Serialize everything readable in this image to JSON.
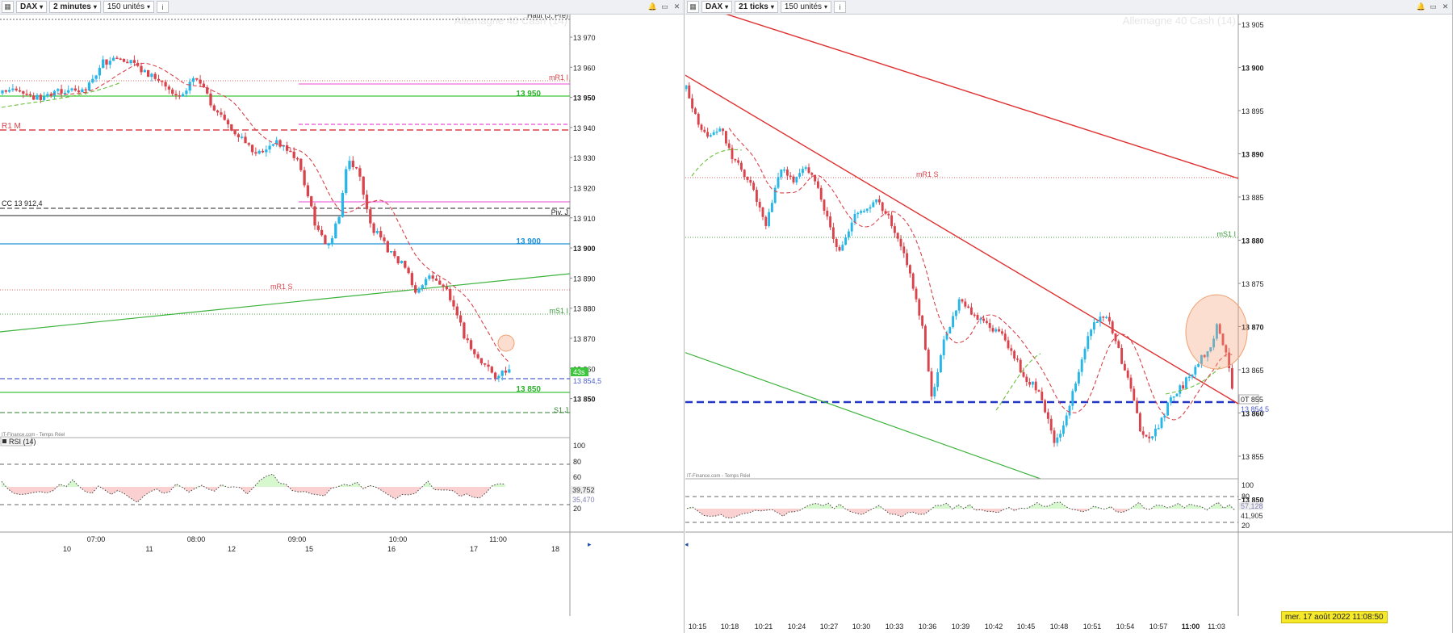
{
  "left": {
    "toolbar": {
      "instrument": "DAX",
      "timeframe": "2 minutes",
      "units": "150 unités",
      "info": "i"
    },
    "watermark": "Allemagne 40 Cash (14)",
    "price_ticks": [
      "13 970",
      "13 960",
      "13 950",
      "13 940",
      "13 930",
      "13 920",
      "13 910",
      "13 900",
      "13 890",
      "13 880",
      "13 870",
      "13 860",
      "13 850"
    ],
    "time_ticks": [
      "07:00",
      "08:00",
      "09:00",
      "10:00",
      "11:00"
    ],
    "date_ticks": [
      "10",
      "11",
      "12",
      "15",
      "16",
      "17",
      "18"
    ],
    "labels": {
      "haut": "Haut (J, Pré)",
      "mr1i": "mR1 I",
      "r1m": "R1 M",
      "cc": "CC 13 912,4",
      "piv": "Piv. J",
      "mr1s": "mR1 S",
      "ms1i": "mS1 I",
      "s1j": "S1 J",
      "l13950": "13 950",
      "l13900": "13 900",
      "l13850": "13 850",
      "price_tag": "43s",
      "price_val": "13 854,5"
    },
    "source": "IT-Finance.com - Temps Réel",
    "rsi": {
      "title": "RSI (14)",
      "levels": [
        "100",
        "80",
        "60",
        "20"
      ],
      "val1": "39,752",
      "val2": "35,470"
    }
  },
  "right": {
    "toolbar": {
      "instrument": "DAX",
      "timeframe": "21 ticks",
      "units": "150 unités",
      "info": "i"
    },
    "watermark": "Allemagne 40 Cash (14)",
    "price_ticks": [
      "13 905",
      "13 900",
      "13 895",
      "13 890",
      "13 885",
      "13 880",
      "13 875",
      "13 870",
      "13 865",
      "13 860",
      "13 855",
      "13 850"
    ],
    "time_ticks": [
      "10:15",
      "10:18",
      "10:21",
      "10:24",
      "10:27",
      "10:30",
      "10:33",
      "10:36",
      "10:39",
      "10:42",
      "10:45",
      "10:48",
      "10:51",
      "10:54",
      "10:57",
      "11:00",
      "11:03"
    ],
    "labels": {
      "mr1s": "mR1 S",
      "ms1i": "mS1 I",
      "price_tag": "0T 855",
      "price_val": "13 854,5"
    },
    "source": "IT-Finance.com - Temps Réel",
    "rsi": {
      "levels": [
        "100",
        "80",
        "20"
      ],
      "val1": "57,128",
      "val2": "41,905"
    },
    "date_badge": "mer. 17 août 2022 11:08:50"
  },
  "colors": {
    "up": "#27b6e8",
    "down": "#d9434b",
    "green": "#3cc63c",
    "blue": "#1e90d8",
    "navy": "#2436c8",
    "pink": "#e84ad0"
  }
}
